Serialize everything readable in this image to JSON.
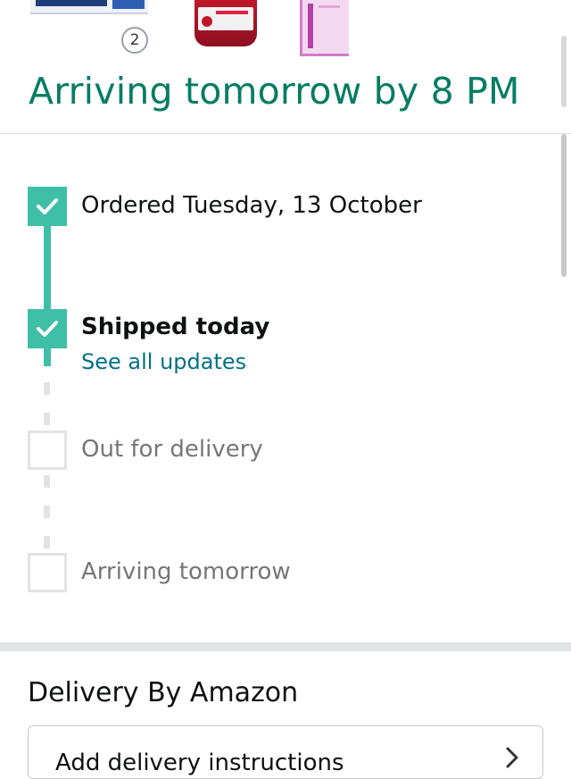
{
  "products": {
    "extra_count": "2"
  },
  "delivery": {
    "headline": "Arriving tomorrow by 8 PM"
  },
  "timeline": {
    "steps": [
      {
        "label": "Ordered Tuesday, 13 October",
        "status": "done"
      },
      {
        "label": "Shipped today",
        "status": "done",
        "link": "See all updates"
      },
      {
        "label": "Out for delivery",
        "status": "pending"
      },
      {
        "label": "Arriving tomorrow",
        "status": "pending"
      }
    ]
  },
  "section": {
    "title": "Delivery By Amazon",
    "instructions_label": "Add delivery instructions"
  },
  "colors": {
    "accent_green": "#067d62",
    "timeline_teal": "#3fbfa8",
    "link": "#007185"
  },
  "icons": [
    "check-icon",
    "chevron-right-icon"
  ]
}
